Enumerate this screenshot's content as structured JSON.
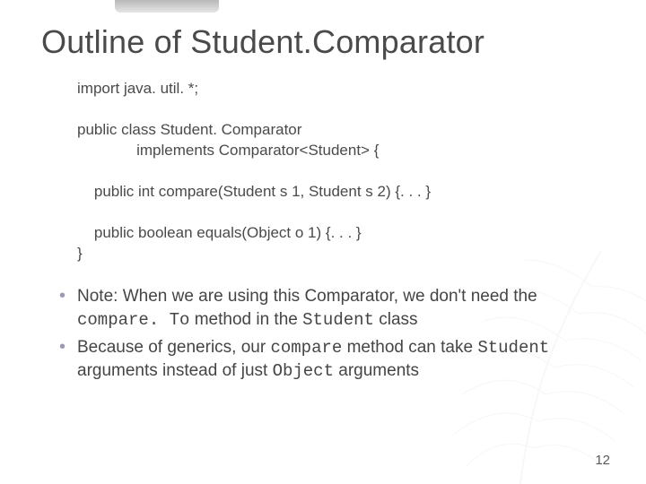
{
  "title": {
    "prefix": "Outline of ",
    "codeword": "Student.Comparator"
  },
  "code": {
    "line1": "import java. util. *;",
    "line3": "public class Student. Comparator",
    "line4": "              implements Comparator<Student> {",
    "line6": "    public int compare(Student s 1, Student s 2) {. . . }",
    "line8": "    public boolean equals(Object o 1) {. . . }",
    "line9": "}"
  },
  "notes": [
    {
      "parts": [
        {
          "t": "Note: When we are using this Comparator, we don't need the ",
          "mono": false
        },
        {
          "t": "compare. To",
          "mono": true
        },
        {
          "t": " method in the ",
          "mono": false
        },
        {
          "t": "Student",
          "mono": true
        },
        {
          "t": " class",
          "mono": false
        }
      ]
    },
    {
      "parts": [
        {
          "t": "Because of generics, our ",
          "mono": false
        },
        {
          "t": "compare",
          "mono": true
        },
        {
          "t": " method can take ",
          "mono": false
        },
        {
          "t": "Student",
          "mono": true
        },
        {
          "t": " arguments instead of just ",
          "mono": false
        },
        {
          "t": "Object",
          "mono": true
        },
        {
          "t": " arguments",
          "mono": false
        }
      ]
    }
  ],
  "page_number": "12"
}
